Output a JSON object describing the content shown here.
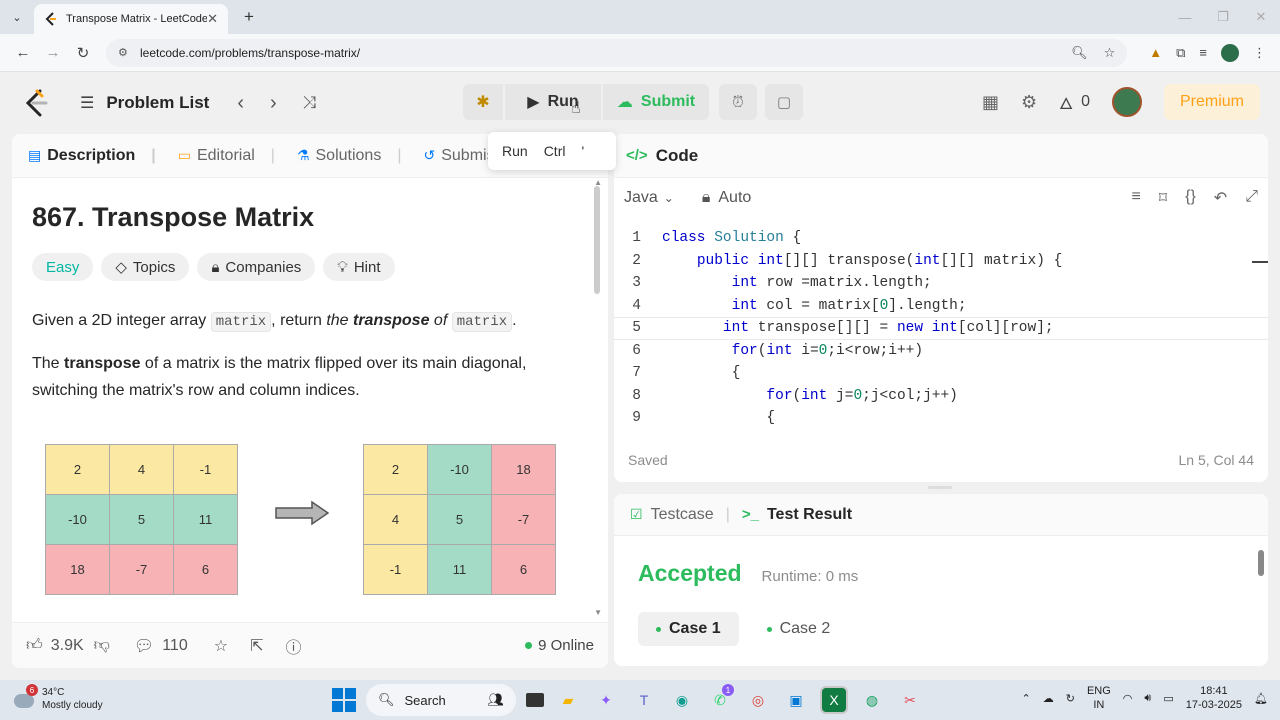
{
  "browser": {
    "tab_title": "Transpose Matrix - LeetCode",
    "url": "leetcode.com/problems/transpose-matrix/"
  },
  "header": {
    "problem_list": "Problem List",
    "run_label": "Run",
    "submit_label": "Submit",
    "streak_count": "0",
    "premium_label": "Premium"
  },
  "tooltip": {
    "label": "Run",
    "shortcut": "Ctrl",
    "key": "'"
  },
  "left_tabs": [
    "Description",
    "Editorial",
    "Solutions",
    "Submiss"
  ],
  "problem": {
    "title": "867. Transpose Matrix",
    "tags": [
      "Easy",
      "Topics",
      "Companies",
      "Hint"
    ],
    "para1": {
      "a": "Given a 2D integer array ",
      "code1": "matrix",
      "b": ", return ",
      "c": "the ",
      "d": "transpose",
      "e": " of ",
      "code2": "matrix",
      "f": "."
    },
    "para2": {
      "a": "The ",
      "b": "transpose",
      "c": " of a matrix is the matrix flipped over its main diagonal, switching the matrix's row and column indices."
    },
    "matrix_a": [
      [
        "2",
        "4",
        "-1"
      ],
      [
        "-10",
        "5",
        "11"
      ],
      [
        "18",
        "-7",
        "6"
      ]
    ],
    "matrix_b": [
      [
        "2",
        "-10",
        "18"
      ],
      [
        "4",
        "5",
        "-7"
      ],
      [
        "-1",
        "11",
        "6"
      ]
    ]
  },
  "colors": {
    "yellow": "#fbe8a2",
    "green": "#a3dbc6",
    "red": "#f7b2b5",
    "accent_green": "#2cbb5d",
    "premium_orange": "#ffa116"
  },
  "bottom_bar": {
    "likes": "3.9K",
    "comments": "110",
    "online": "9 Online"
  },
  "code_panel": {
    "tab_label": "Code",
    "language": "Java",
    "auto_label": "Auto",
    "saved_label": "Saved",
    "cursor_pos": "Ln 5, Col 44",
    "lines": [
      {
        "n": "1",
        "text": "class Solution {"
      },
      {
        "n": "2",
        "text": "    public int[][] transpose(int[][] matrix) {"
      },
      {
        "n": "3",
        "text": "        int row =matrix.length;"
      },
      {
        "n": "4",
        "text": "        int col = matrix[0].length;"
      },
      {
        "n": "5",
        "text": "       int transpose[][] = new int[col][row];"
      },
      {
        "n": "6",
        "text": "        for(int i=0;i<row;i++)"
      },
      {
        "n": "7",
        "text": "        {"
      },
      {
        "n": "8",
        "text": "            for(int j=0;j<col;j++)"
      },
      {
        "n": "9",
        "text": "            {"
      }
    ]
  },
  "result_panel": {
    "testcase_label": "Testcase",
    "result_label": "Test Result",
    "status": "Accepted",
    "runtime": "Runtime: 0 ms",
    "cases": [
      "Case 1",
      "Case 2"
    ]
  },
  "taskbar": {
    "notif_count": "6",
    "temperature": "34°C",
    "weather": "Mostly cloudy",
    "search_label": "Search",
    "teams_badge": "1",
    "lang_line1": "ENG",
    "lang_line2": "IN",
    "time": "18:41",
    "date": "17-03-2025"
  }
}
